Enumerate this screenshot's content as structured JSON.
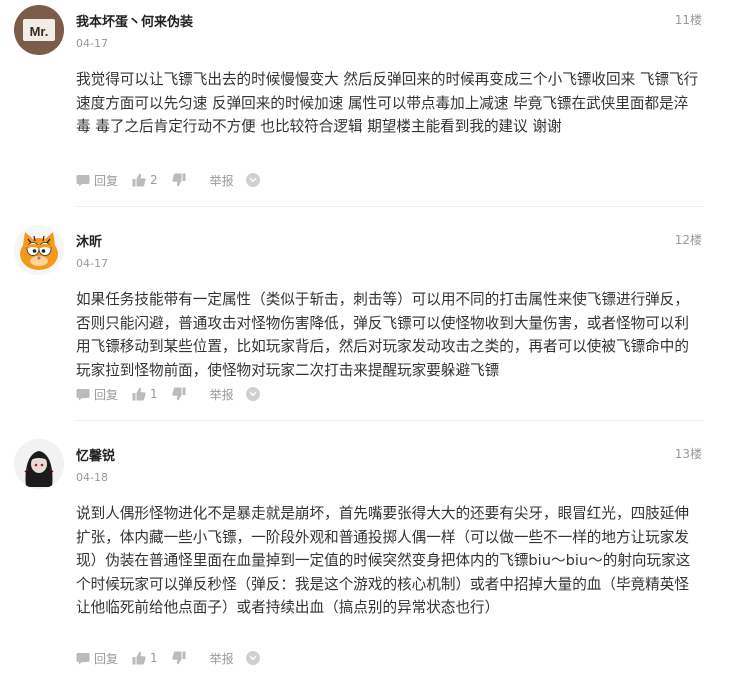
{
  "labels": {
    "reply": "回复",
    "report": "举报"
  },
  "comments": [
    {
      "username": "我本坏蛋丶何来伪装",
      "avatar_text": "Mr.",
      "date": "04-17",
      "floor": "11楼",
      "content": "  我觉得可以让飞镖飞出去的时候慢慢变大  然后反弹回来的时候再变成三个小飞镖收回来  飞镖飞行速度方面可以先匀速  反弹回来的时候加速   属性可以带点毒加上减速  毕竟飞镖在武侠里面都是淬毒  毒了之后肯定行动不方便  也比较符合逻辑  期望楼主能看到我的建议  谢谢",
      "likes": "2"
    },
    {
      "username": "沐昕",
      "date": "04-17",
      "floor": "12楼",
      "content": "如果任务技能带有一定属性（类似于斩击，刺击等）可以用不同的打击属性来使飞镖进行弹反，否则只能闪避，普通攻击对怪物伤害降低，弹反飞镖可以使怪物收到大量伤害，或者怪物可以利用飞镖移动到某些位置，比如玩家背后，然后对玩家发动攻击之类的，再者可以使被飞镖命中的玩家拉到怪物前面，使怪物对玩家二次打击来提醒玩家要躲避飞镖",
      "likes": "1"
    },
    {
      "username": "忆馨锐",
      "date": "04-18",
      "floor": "13楼",
      "content": "说到人偶形怪物进化不是暴走就是崩坏，首先嘴要张得大大的还要有尖牙，眼冒红光，四肢延伸扩张，体内藏一些小飞镖，一阶段外观和普通投掷人偶一样（可以做一些不一样的地方让玩家发现）伪装在普通怪里面在血量掉到一定值的时候突然变身把体内的飞镖biu～biu～的射向玩家这个时候玩家可以弹反秒怪（弹反：我是这个游戏的核心机制）或者中招掉大量的血（毕竟精英怪让他临死前给他点面子）或者持续出血（搞点别的异常状态也行）",
      "likes": "1"
    }
  ],
  "colors": {
    "text": "#333333",
    "muted": "#999999",
    "divider": "#eeeeee"
  },
  "icons": [
    "reply-icon",
    "like-icon",
    "dislike-icon",
    "more-chevron-icon"
  ]
}
